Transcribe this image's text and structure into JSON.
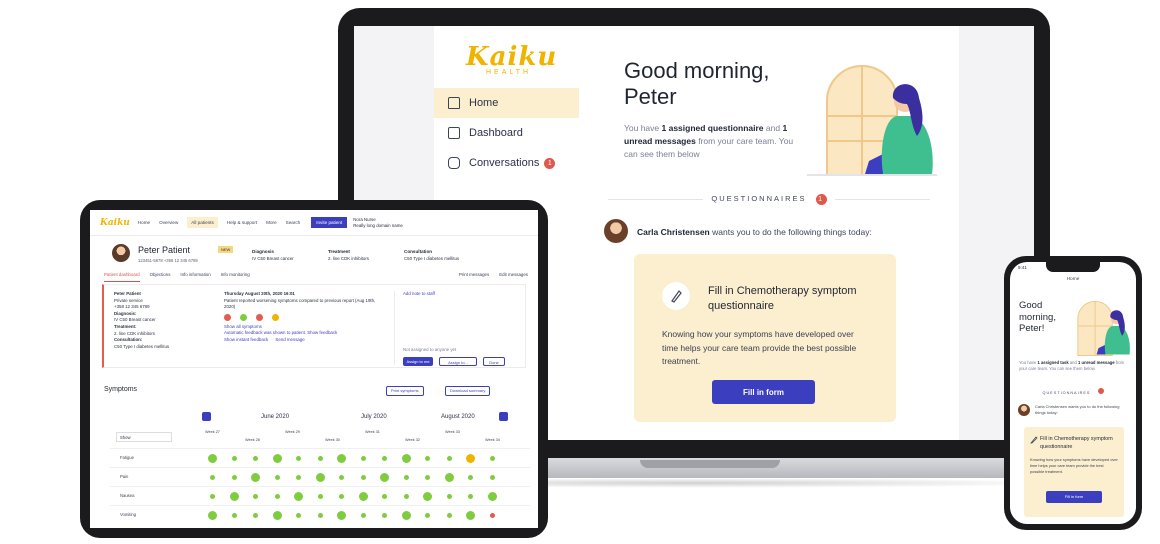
{
  "colors": {
    "brand": "#f0b400",
    "accent": "#3b3fbf",
    "highlight": "#fcefcf",
    "alert": "#e2574c"
  },
  "laptop": {
    "logo": "Kaiku",
    "logo_sub": "HEALTH",
    "nav": [
      {
        "label": "Home",
        "icon": "home-icon"
      },
      {
        "label": "Dashboard",
        "icon": "dashboard-icon"
      },
      {
        "label": "Conversations",
        "icon": "chat-icon",
        "badge": "1"
      }
    ],
    "greeting": "Good morning, Peter",
    "summary": {
      "pre": "You have ",
      "q": "1 assigned questionnaire",
      "mid": " and ",
      "m": "1 unread messages",
      "post": " from your care team. You can see them below"
    },
    "questionnaires_label": "QUESTIONNAIRES",
    "questionnaires_badge": "1",
    "requester": "Carla Christensen",
    "request_text": " wants you to do the following things today:",
    "card": {
      "title": "Fill in Chemotherapy symptom questionnaire",
      "text": "Knowing how your symptoms have developed over time helps your care team provide the best possible treatment.",
      "button": "Fill in form"
    }
  },
  "tablet": {
    "logo": "Kaiku",
    "nav": [
      "Home",
      "Overview",
      "All patients",
      "Help & support",
      "More",
      "Search"
    ],
    "invite": "Invite patient",
    "user": [
      "Nora Nurse",
      "Really long domain name"
    ],
    "patient": "Peter Patient",
    "patient_tag": "NEW",
    "patient_meta": "123451-5678    +358 12 345 6789",
    "columns": [
      {
        "title": "Diagnosis",
        "value": "IV C50 Breast cancer"
      },
      {
        "title": "Treatment",
        "value": "2. line CDK inhibitors"
      },
      {
        "title": "Consultation",
        "value": "C50 Type I diabetes mellitus"
      }
    ],
    "tabs": [
      "Patient dashboard",
      "Objections",
      "Info information",
      "Info monitoring"
    ],
    "tabs_right": [
      "Print messages",
      "Edit messages"
    ],
    "feed_left": [
      "Peter Patient",
      "Private service",
      "+358 12 345 6789",
      "Diagnosis:",
      "IV C50 Breast cancer",
      "Treatment:",
      "2. line CDK inhibitors",
      "Consultation:",
      "C50 Type I diabetes mellitus"
    ],
    "feed_mid_title": "Thursday August 20th, 2020 16:01",
    "feed_mid_text": "Patient reported worsening symptoms compared to previous report (Aug 19th, 2020)",
    "feed_dots": [
      "#e35c4f",
      "#7fcc3f",
      "#e35c4f",
      "#f0b400"
    ],
    "feed_links": [
      "Show all symptoms",
      "Automatic feedback was shown to patient. Show feedback",
      "Show instant feedback",
      "Send message"
    ],
    "feed_right_link": "Add note to staff",
    "feed_right_note": "Not assigned to anyone yet",
    "feed_buttons": [
      "Assign to me",
      "Assign to...",
      "Done"
    ],
    "symptoms_title": "Symptoms",
    "symptom_buttons": [
      "Print symptoms",
      "Download summary"
    ],
    "months": [
      "June 2020",
      "July 2020",
      "August 2020"
    ],
    "filter": "Show",
    "weeks": [
      "Week 27",
      "Week 28",
      "Week 29",
      "Week 30",
      "Week 31",
      "Week 32",
      "Week 33",
      "Week 34"
    ],
    "rows": [
      "Fatigue",
      "Pain",
      "Nausea",
      "Vomiting"
    ]
  },
  "phone": {
    "time": "9:41",
    "header": "Home",
    "greeting": "Good morning, Peter!",
    "summary": {
      "pre": "You have ",
      "t": "1 assigned task",
      "mid": " and ",
      "m": "1 unread message",
      "post": " from your care team. You can see them below."
    },
    "questionnaires_label": "QUESTIONNAIRES",
    "request": "Carla Christensen wants you to do the following things today:",
    "card": {
      "title": "Fill in Chemotherapy symptom questionnaire",
      "text": "Knowing how your symptoms have developed over time helps your care team provide the best possible treatment.",
      "button": "Fill in form"
    }
  }
}
